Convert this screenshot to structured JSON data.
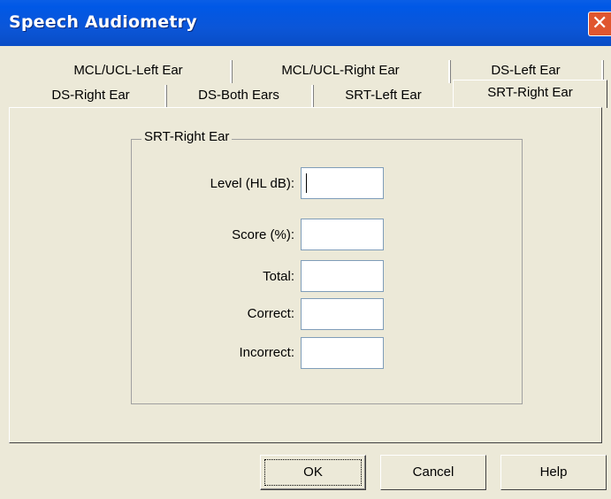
{
  "window": {
    "title": "Speech Audiometry",
    "close_glyph": "✕"
  },
  "tabs_row1": [
    {
      "label": "MCL/UCL-Left Ear"
    },
    {
      "label": "MCL/UCL-Right Ear"
    },
    {
      "label": "DS-Left Ear"
    }
  ],
  "tabs_row2": [
    {
      "label": "DS-Right Ear"
    },
    {
      "label": "DS-Both Ears"
    },
    {
      "label": "SRT-Left Ear"
    },
    {
      "label": "SRT-Right Ear",
      "active": true
    }
  ],
  "group": {
    "title": "SRT-Right Ear",
    "fields": [
      {
        "label": "Level (HL dB):",
        "value": ""
      },
      {
        "label": "Score (%):",
        "value": ""
      },
      {
        "label": "Total:",
        "value": ""
      },
      {
        "label": "Correct:",
        "value": ""
      },
      {
        "label": "Incorrect:",
        "value": ""
      }
    ]
  },
  "buttons": {
    "ok": "OK",
    "cancel": "Cancel",
    "help": "Help"
  }
}
